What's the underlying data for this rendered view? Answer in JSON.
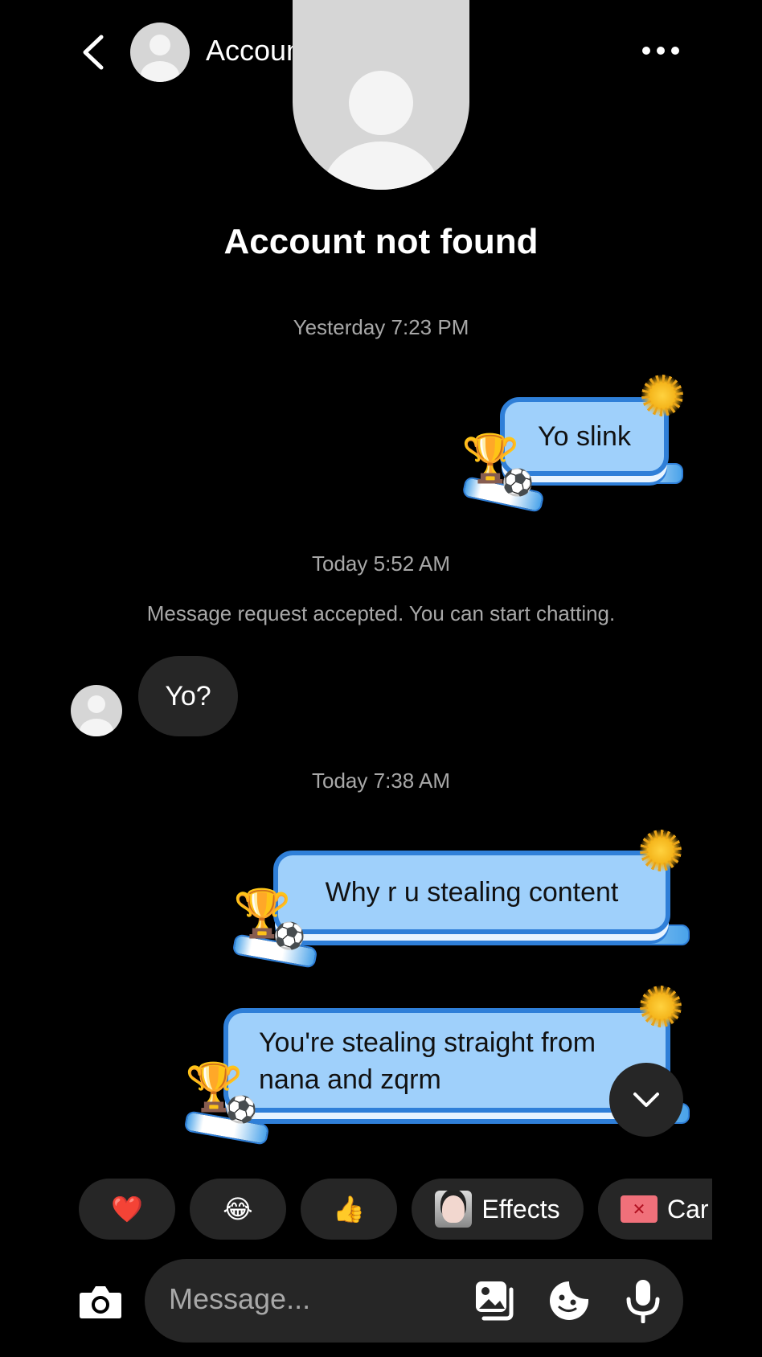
{
  "header": {
    "title": "Account not found"
  },
  "profile": {
    "name": "Account not found"
  },
  "thread": {
    "ts1": "Yesterday 7:23 PM",
    "msg1": "Yo slink",
    "ts2": "Today 5:52 AM",
    "system": "Message request accepted. You can start chatting.",
    "incoming1": "Yo?",
    "ts3": "Today 7:38 AM",
    "msg2": "Why r u stealing content",
    "msg3_line1": "You're stealing straight from",
    "msg3_line2": "nana and zqrm"
  },
  "quick": {
    "heart": "❤️",
    "laugh": "😂",
    "thumbs": "👍",
    "effects": "Effects",
    "cards": "Car"
  },
  "composer": {
    "placeholder": "Message..."
  },
  "colors": {
    "bubble": "#9fd0fb",
    "bubble_border": "#2f7fd8",
    "background": "#000000"
  }
}
